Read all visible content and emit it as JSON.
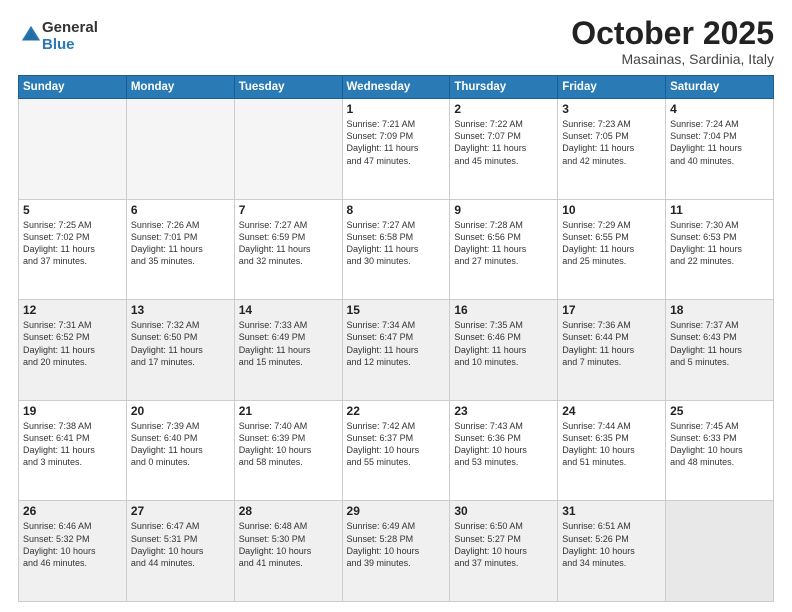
{
  "logo": {
    "general": "General",
    "blue": "Blue"
  },
  "title": "October 2025",
  "location": "Masainas, Sardinia, Italy",
  "days_of_week": [
    "Sunday",
    "Monday",
    "Tuesday",
    "Wednesday",
    "Thursday",
    "Friday",
    "Saturday"
  ],
  "weeks": [
    {
      "shaded": false,
      "days": [
        {
          "day": "",
          "info": ""
        },
        {
          "day": "",
          "info": ""
        },
        {
          "day": "",
          "info": ""
        },
        {
          "day": "1",
          "info": "Sunrise: 7:21 AM\nSunset: 7:09 PM\nDaylight: 11 hours\nand 47 minutes."
        },
        {
          "day": "2",
          "info": "Sunrise: 7:22 AM\nSunset: 7:07 PM\nDaylight: 11 hours\nand 45 minutes."
        },
        {
          "day": "3",
          "info": "Sunrise: 7:23 AM\nSunset: 7:05 PM\nDaylight: 11 hours\nand 42 minutes."
        },
        {
          "day": "4",
          "info": "Sunrise: 7:24 AM\nSunset: 7:04 PM\nDaylight: 11 hours\nand 40 minutes."
        }
      ]
    },
    {
      "shaded": false,
      "days": [
        {
          "day": "5",
          "info": "Sunrise: 7:25 AM\nSunset: 7:02 PM\nDaylight: 11 hours\nand 37 minutes."
        },
        {
          "day": "6",
          "info": "Sunrise: 7:26 AM\nSunset: 7:01 PM\nDaylight: 11 hours\nand 35 minutes."
        },
        {
          "day": "7",
          "info": "Sunrise: 7:27 AM\nSunset: 6:59 PM\nDaylight: 11 hours\nand 32 minutes."
        },
        {
          "day": "8",
          "info": "Sunrise: 7:27 AM\nSunset: 6:58 PM\nDaylight: 11 hours\nand 30 minutes."
        },
        {
          "day": "9",
          "info": "Sunrise: 7:28 AM\nSunset: 6:56 PM\nDaylight: 11 hours\nand 27 minutes."
        },
        {
          "day": "10",
          "info": "Sunrise: 7:29 AM\nSunset: 6:55 PM\nDaylight: 11 hours\nand 25 minutes."
        },
        {
          "day": "11",
          "info": "Sunrise: 7:30 AM\nSunset: 6:53 PM\nDaylight: 11 hours\nand 22 minutes."
        }
      ]
    },
    {
      "shaded": true,
      "days": [
        {
          "day": "12",
          "info": "Sunrise: 7:31 AM\nSunset: 6:52 PM\nDaylight: 11 hours\nand 20 minutes."
        },
        {
          "day": "13",
          "info": "Sunrise: 7:32 AM\nSunset: 6:50 PM\nDaylight: 11 hours\nand 17 minutes."
        },
        {
          "day": "14",
          "info": "Sunrise: 7:33 AM\nSunset: 6:49 PM\nDaylight: 11 hours\nand 15 minutes."
        },
        {
          "day": "15",
          "info": "Sunrise: 7:34 AM\nSunset: 6:47 PM\nDaylight: 11 hours\nand 12 minutes."
        },
        {
          "day": "16",
          "info": "Sunrise: 7:35 AM\nSunset: 6:46 PM\nDaylight: 11 hours\nand 10 minutes."
        },
        {
          "day": "17",
          "info": "Sunrise: 7:36 AM\nSunset: 6:44 PM\nDaylight: 11 hours\nand 7 minutes."
        },
        {
          "day": "18",
          "info": "Sunrise: 7:37 AM\nSunset: 6:43 PM\nDaylight: 11 hours\nand 5 minutes."
        }
      ]
    },
    {
      "shaded": false,
      "days": [
        {
          "day": "19",
          "info": "Sunrise: 7:38 AM\nSunset: 6:41 PM\nDaylight: 11 hours\nand 3 minutes."
        },
        {
          "day": "20",
          "info": "Sunrise: 7:39 AM\nSunset: 6:40 PM\nDaylight: 11 hours\nand 0 minutes."
        },
        {
          "day": "21",
          "info": "Sunrise: 7:40 AM\nSunset: 6:39 PM\nDaylight: 10 hours\nand 58 minutes."
        },
        {
          "day": "22",
          "info": "Sunrise: 7:42 AM\nSunset: 6:37 PM\nDaylight: 10 hours\nand 55 minutes."
        },
        {
          "day": "23",
          "info": "Sunrise: 7:43 AM\nSunset: 6:36 PM\nDaylight: 10 hours\nand 53 minutes."
        },
        {
          "day": "24",
          "info": "Sunrise: 7:44 AM\nSunset: 6:35 PM\nDaylight: 10 hours\nand 51 minutes."
        },
        {
          "day": "25",
          "info": "Sunrise: 7:45 AM\nSunset: 6:33 PM\nDaylight: 10 hours\nand 48 minutes."
        }
      ]
    },
    {
      "shaded": true,
      "days": [
        {
          "day": "26",
          "info": "Sunrise: 6:46 AM\nSunset: 5:32 PM\nDaylight: 10 hours\nand 46 minutes."
        },
        {
          "day": "27",
          "info": "Sunrise: 6:47 AM\nSunset: 5:31 PM\nDaylight: 10 hours\nand 44 minutes."
        },
        {
          "day": "28",
          "info": "Sunrise: 6:48 AM\nSunset: 5:30 PM\nDaylight: 10 hours\nand 41 minutes."
        },
        {
          "day": "29",
          "info": "Sunrise: 6:49 AM\nSunset: 5:28 PM\nDaylight: 10 hours\nand 39 minutes."
        },
        {
          "day": "30",
          "info": "Sunrise: 6:50 AM\nSunset: 5:27 PM\nDaylight: 10 hours\nand 37 minutes."
        },
        {
          "day": "31",
          "info": "Sunrise: 6:51 AM\nSunset: 5:26 PM\nDaylight: 10 hours\nand 34 minutes."
        },
        {
          "day": "",
          "info": ""
        }
      ]
    }
  ]
}
